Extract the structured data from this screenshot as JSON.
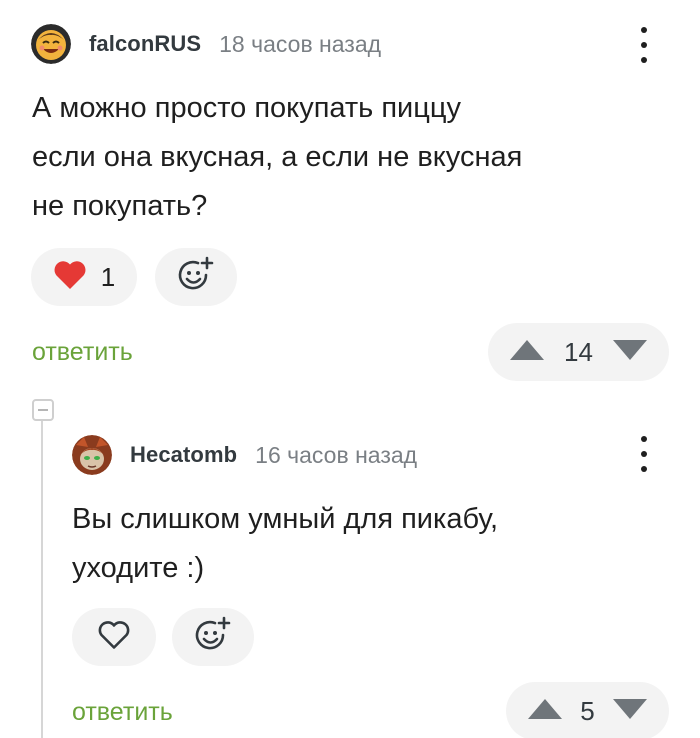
{
  "comments": [
    {
      "author": "falconRUS",
      "time": "18 часов назад",
      "text_lines": [
        "А можно просто покупать пиццу",
        "если она вкусная, а если не вкусная",
        "не покупать?"
      ],
      "likes": "1",
      "liked": true,
      "reply_label": "ответить",
      "rating": "14",
      "avatar_icon": "smiling-face-avatar"
    },
    {
      "author": "Hecatomb",
      "time": "16 часов назад",
      "text_lines": [
        "Вы слишком умный для пикабу,",
        "уходите :)"
      ],
      "likes": "",
      "liked": false,
      "reply_label": "ответить",
      "rating": "5",
      "avatar_icon": "cartoon-character-avatar"
    }
  ],
  "colors": {
    "accent_green": "#6aa33a",
    "like_red": "#e53935",
    "pill_bg": "#f3f3f3",
    "muted_text": "#7a7f84"
  }
}
